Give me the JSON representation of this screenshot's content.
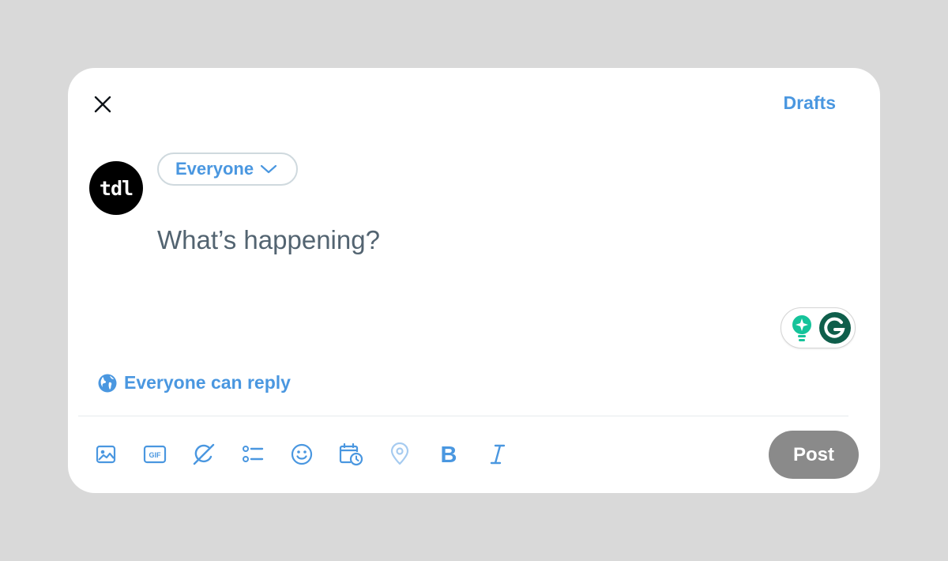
{
  "header": {
    "drafts_label": "Drafts"
  },
  "avatar": {
    "text": "tdl"
  },
  "audience": {
    "label": "Everyone"
  },
  "composer": {
    "placeholder": "What’s happening?",
    "value": ""
  },
  "reply_setting": {
    "label": "Everyone can reply"
  },
  "toolbar": {
    "gif_label": "GIF",
    "bold_label": "B",
    "italic_label": "I",
    "icons": [
      "media-icon",
      "gif-icon",
      "grok-icon",
      "poll-icon",
      "emoji-icon",
      "schedule-icon",
      "location-icon",
      "bold-icon",
      "italic-icon"
    ]
  },
  "post": {
    "label": "Post"
  },
  "colors": {
    "accent": "#4a97e0",
    "post_disabled": "#8a8a8a",
    "grammarly": "#15c39a",
    "grammarly_dark": "#0f5e4b",
    "background": "#d9d9d9"
  }
}
